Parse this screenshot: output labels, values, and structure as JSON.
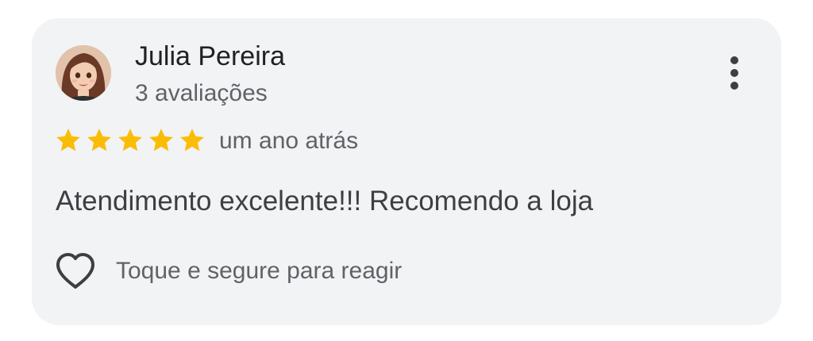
{
  "review": {
    "author": "Julia Pereira",
    "review_count": "3 avaliações",
    "rating": 5,
    "rating_max": 5,
    "time": "um ano atrás",
    "text": "Atendimento excelente!!! Recomendo a loja",
    "react_label": "Toque e segure para reagir",
    "more_icon": "more-vert-icon",
    "heart_icon": "heart-outline-icon"
  },
  "colors": {
    "card_bg": "#f2f3f5",
    "star": "#fbbc04",
    "primary_text": "#202124",
    "secondary_text": "#5f6368"
  }
}
